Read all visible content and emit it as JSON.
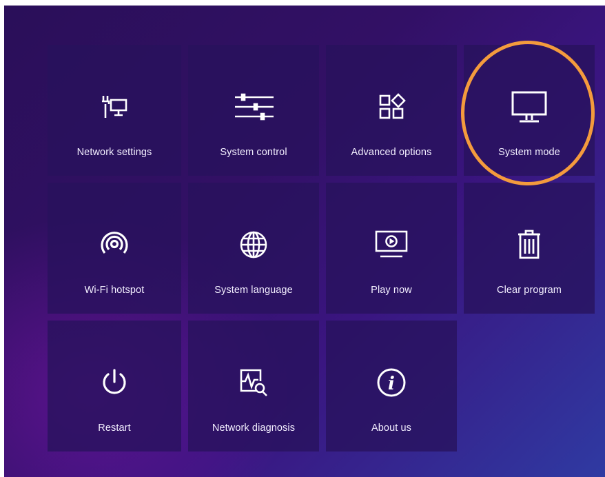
{
  "menu": {
    "tiles": [
      {
        "label": "Network settings",
        "icon": "network-settings-icon"
      },
      {
        "label": "System control",
        "icon": "sliders-icon"
      },
      {
        "label": "Advanced options",
        "icon": "apps-grid-icon"
      },
      {
        "label": "System mode",
        "icon": "monitor-icon"
      },
      {
        "label": "Wi-Fi hotspot",
        "icon": "hotspot-icon"
      },
      {
        "label": "System language",
        "icon": "globe-icon"
      },
      {
        "label": "Play now",
        "icon": "play-screen-icon"
      },
      {
        "label": "Clear program",
        "icon": "trash-icon"
      },
      {
        "label": "Restart",
        "icon": "power-icon"
      },
      {
        "label": "Network diagnosis",
        "icon": "diagnosis-icon"
      },
      {
        "label": "About us",
        "icon": "info-icon"
      }
    ],
    "highlight": {
      "target": "System mode",
      "color": "#f49b3d"
    }
  }
}
